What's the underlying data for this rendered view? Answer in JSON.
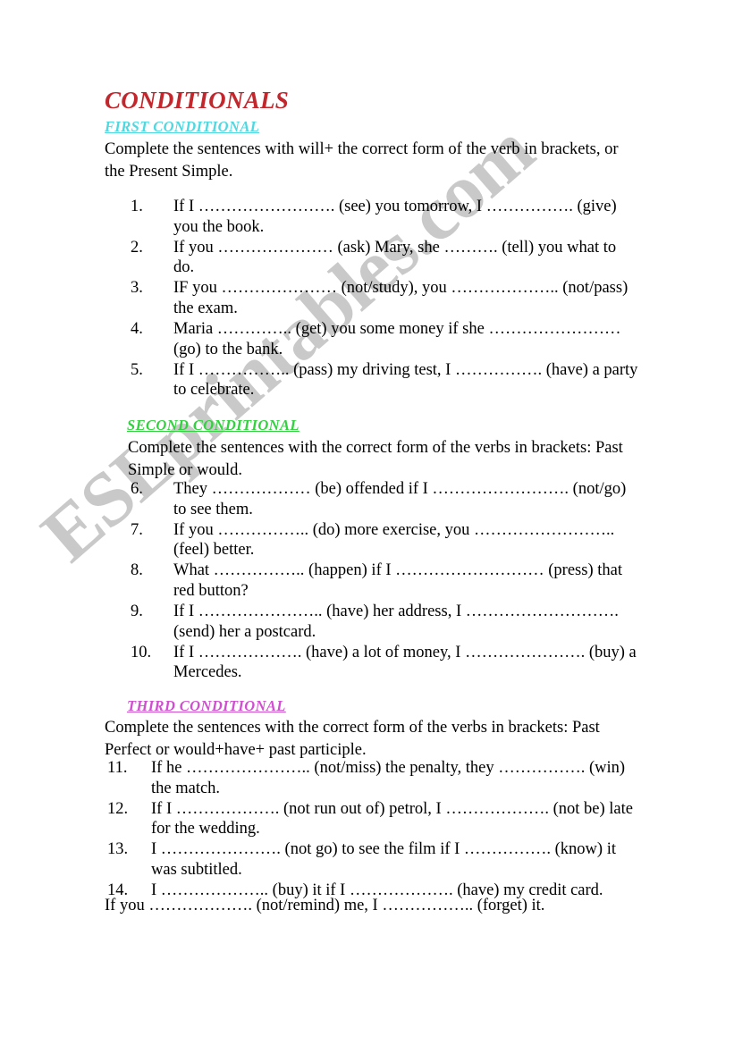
{
  "document": {
    "title": "CONDITIONALS",
    "title_color": "#c1272d",
    "watermark": "ESLprintables.com",
    "watermark_color": "#c9c9c9"
  },
  "sections": [
    {
      "heading": "FIRST CONDITIONAL",
      "heading_color": "#4fd8e0",
      "instructions": "Complete the sentences with will+ the correct form of the verb in brackets, or the Present Simple.",
      "items": [
        {
          "number": "1.",
          "text": "If I ……………………. (see) you tomorrow, I ……………. (give) you the book."
        },
        {
          "number": "2.",
          "text": "If you ………………… (ask) Mary, she ………. (tell) you what to do."
        },
        {
          "number": "3.",
          "text": "IF you ………………… (not/study), you ……………….. (not/pass) the exam."
        },
        {
          "number": "4.",
          "text": "Maria ………….. (get) you some money if she …………………… (go) to the bank."
        },
        {
          "number": "5.",
          "text": "If I …………….. (pass) my driving test, I ……………. (have) a party to celebrate."
        }
      ]
    },
    {
      "heading": "SECOND CONDITIONAL",
      "heading_color": "#33d13f",
      "instructions": "Complete the sentences with the correct form of the verbs in brackets: Past Simple or would.",
      "items": [
        {
          "number": "6.",
          "text": "They ……………… (be) offended if I ……………………. (not/go) to see them."
        },
        {
          "number": "7.",
          "text": "If you …………….. (do) more exercise, you …………………….. (feel) better."
        },
        {
          "number": "8.",
          "text": "What …………….. (happen) if I ……………………… (press) that red button?"
        },
        {
          "number": "9.",
          "text": "If I ………………….. (have) her address, I ………………………. (send) her a postcard."
        },
        {
          "number": "10.",
          "text": "If I ………………. (have) a lot of money, I …………………. (buy) a Mercedes."
        }
      ]
    },
    {
      "heading": "THIRD CONDITIONAL",
      "heading_color": "#d04fd0",
      "instructions": "Complete the sentences with the correct form of the verbs in brackets: Past Perfect or would+have+ past participle.",
      "items": [
        {
          "number": "11.",
          "text": "If he ………………….. (not/miss) the penalty, they ……………. (win) the match."
        },
        {
          "number": "12.",
          "text": "If I ………………. (not run out of) petrol, I ………………. (not be) late for the wedding."
        },
        {
          "number": "13.",
          "text": "I …………………. (not go) to see the film if I ……………. (know) it was subtitled."
        },
        {
          "number": "14.",
          "text": "I ……………….. (buy) it if I ………………. (have) my credit card."
        }
      ]
    }
  ],
  "closing_line": "If you ………………. (not/remind) me, I …………….. (forget) it."
}
